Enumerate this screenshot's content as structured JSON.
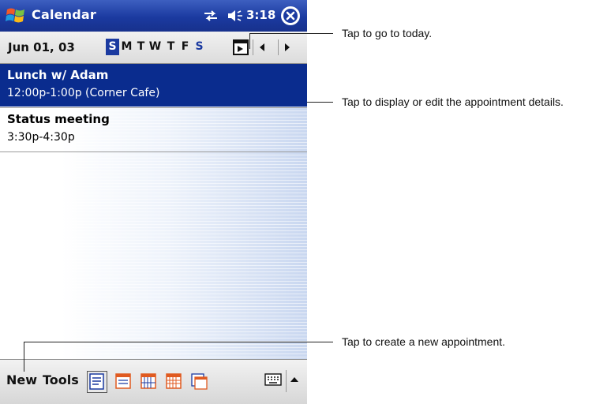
{
  "title_bar": {
    "app_title": "Calendar",
    "clock": "3:18",
    "icons": [
      "windows-start-icon",
      "sync-icon",
      "speaker-icon",
      "close-icon"
    ]
  },
  "date_bar": {
    "current_date": "Jun 01, 03",
    "days": [
      "S",
      "M",
      "T",
      "W",
      "T",
      "F",
      "S"
    ],
    "selected_day_index": 0
  },
  "appointments": [
    {
      "subject": "Lunch w/ Adam",
      "detail": "12:00p-1:00p (Corner Cafe)",
      "selected": true
    },
    {
      "subject": "Status meeting",
      "detail": "3:30p-4:30p",
      "selected": false
    }
  ],
  "toolbar": {
    "new_label": "New",
    "tools_label": "Tools",
    "view_icons": [
      "agenda-view-icon",
      "day-view-icon",
      "week-view-icon",
      "month-view-icon",
      "year-view-icon"
    ]
  },
  "callouts": {
    "today": "Tap to go to today.",
    "details": "Tap to display or edit the appointment details.",
    "new": "Tap to create a new appointment."
  },
  "colors": {
    "title_bar": "#1b3aa0",
    "selection": "#0a2c8e"
  }
}
